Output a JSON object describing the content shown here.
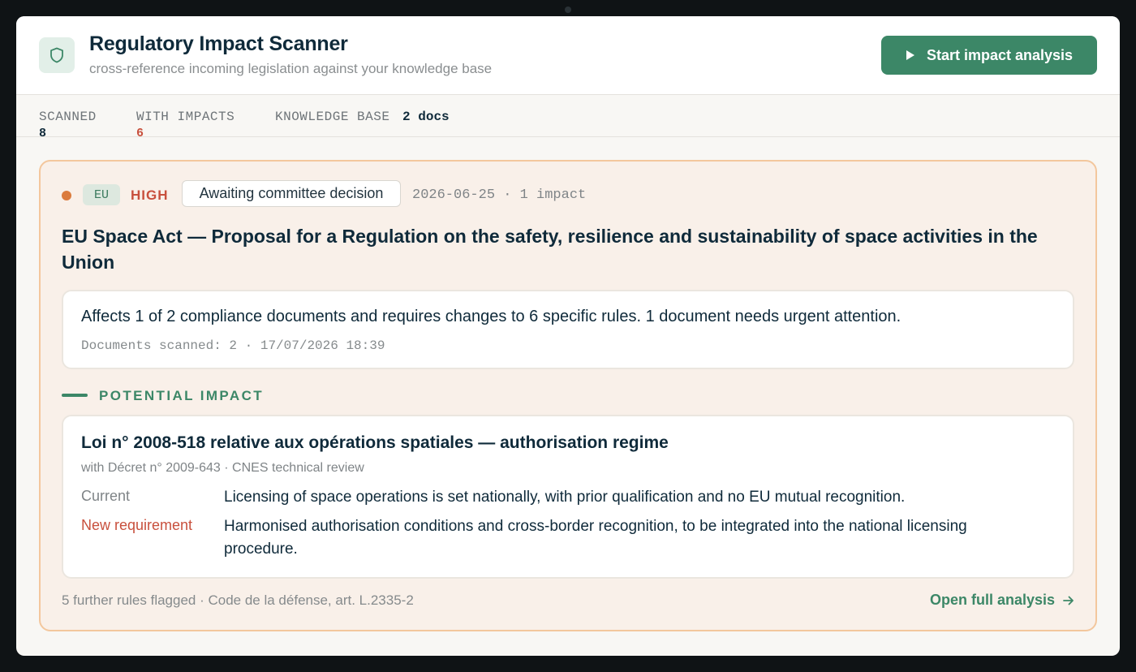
{
  "header": {
    "title": "Regulatory Impact Scanner",
    "subtitle": "cross-reference incoming legislation against your knowledge base",
    "start_button": "Start impact analysis"
  },
  "stats": {
    "scanned_label": "SCANNED",
    "scanned_value": "8",
    "impacts_label": "WITH IMPACTS",
    "impacts_value": "6",
    "kb_label": "KNOWLEDGE BASE",
    "kb_value": "2 docs"
  },
  "card": {
    "region": "EU",
    "severity": "HIGH",
    "status": "Awaiting committee decision",
    "meta": "2026-06-25 · 1 impact",
    "title": "EU Space Act — Proposal for a Regulation on the safety, resilience and sustainability of space activities in the Union",
    "summary": "Affects 1 of 2 compliance documents and requires changes to 6 specific rules. 1 document needs urgent attention.",
    "summary_meta": "Documents scanned: 2 · 17/07/2026 18:39",
    "section_label": "POTENTIAL IMPACT",
    "impact": {
      "title": "Loi n° 2008-518 relative aux opérations spatiales — authorisation regime",
      "subtitle": "with Décret n° 2009-643 · CNES technical review",
      "current_label": "Current",
      "current_text": "Licensing of space operations is set nationally, with prior qualification and no EU mutual recognition.",
      "new_label": "New requirement",
      "new_text": "Harmonised authorisation conditions and cross-border recognition, to be integrated into the national licensing procedure."
    },
    "footer_note": "5 further rules flagged · Code de la défense, art. L.2335-2",
    "open_link": "Open full analysis"
  },
  "colors": {
    "accent": "#3c8767",
    "severity_high": "#c8503d",
    "card_bg": "#f9f0e9",
    "card_border": "#f3c79d"
  },
  "icons": {
    "logo": "shield-icon",
    "start": "play-icon",
    "severity_dot": "status-dot-icon",
    "open": "arrow-right-icon"
  }
}
